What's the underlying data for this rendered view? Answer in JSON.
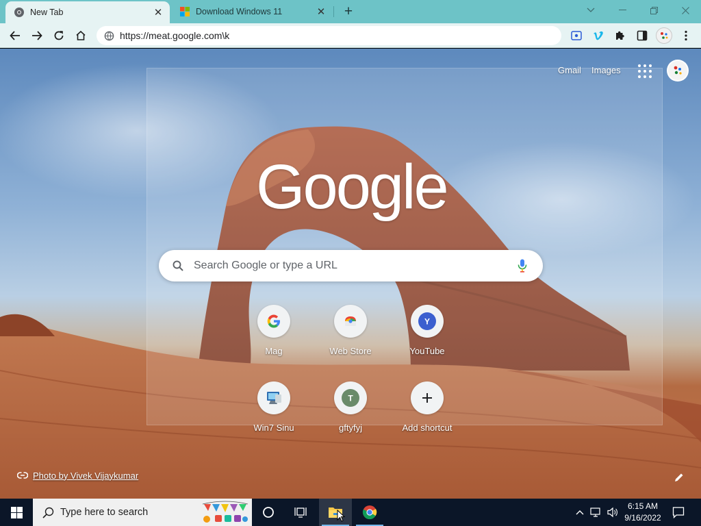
{
  "browser": {
    "tabs": [
      {
        "title": "New Tab",
        "icon": "chrome-icon",
        "active": true
      },
      {
        "title": "Download Windows 11",
        "icon": "windows-logo-icon",
        "active": false
      }
    ],
    "url": "https://meat.google.com\\k",
    "accent": "#6dc3c7",
    "toolbar_bg": "#e6f3f3"
  },
  "ntp": {
    "top_links": {
      "gmail": "Gmail",
      "images": "Images"
    },
    "logo": "Google",
    "search_placeholder": "Search Google or type a URL",
    "shortcuts": [
      {
        "label": "Mag",
        "icon": "google-g-icon"
      },
      {
        "label": "Web Store",
        "icon": "webstore-icon"
      },
      {
        "label": "YouTube",
        "icon": "letter-avatar",
        "letter": "Y",
        "color": "#3b5fcf"
      },
      {
        "label": "Win7 Sinu",
        "icon": "computer-icon"
      },
      {
        "label": "gftyfyj",
        "icon": "letter-avatar",
        "letter": "T",
        "color": "#6a8b6a"
      },
      {
        "label": "Add shortcut",
        "icon": "plus-icon"
      }
    ],
    "photo_credit": "Photo by Vivek Vijaykumar"
  },
  "taskbar": {
    "search_placeholder": "Type here to search",
    "time": "6:15 AM",
    "date": "9/16/2022",
    "bg": "#0b1628"
  }
}
